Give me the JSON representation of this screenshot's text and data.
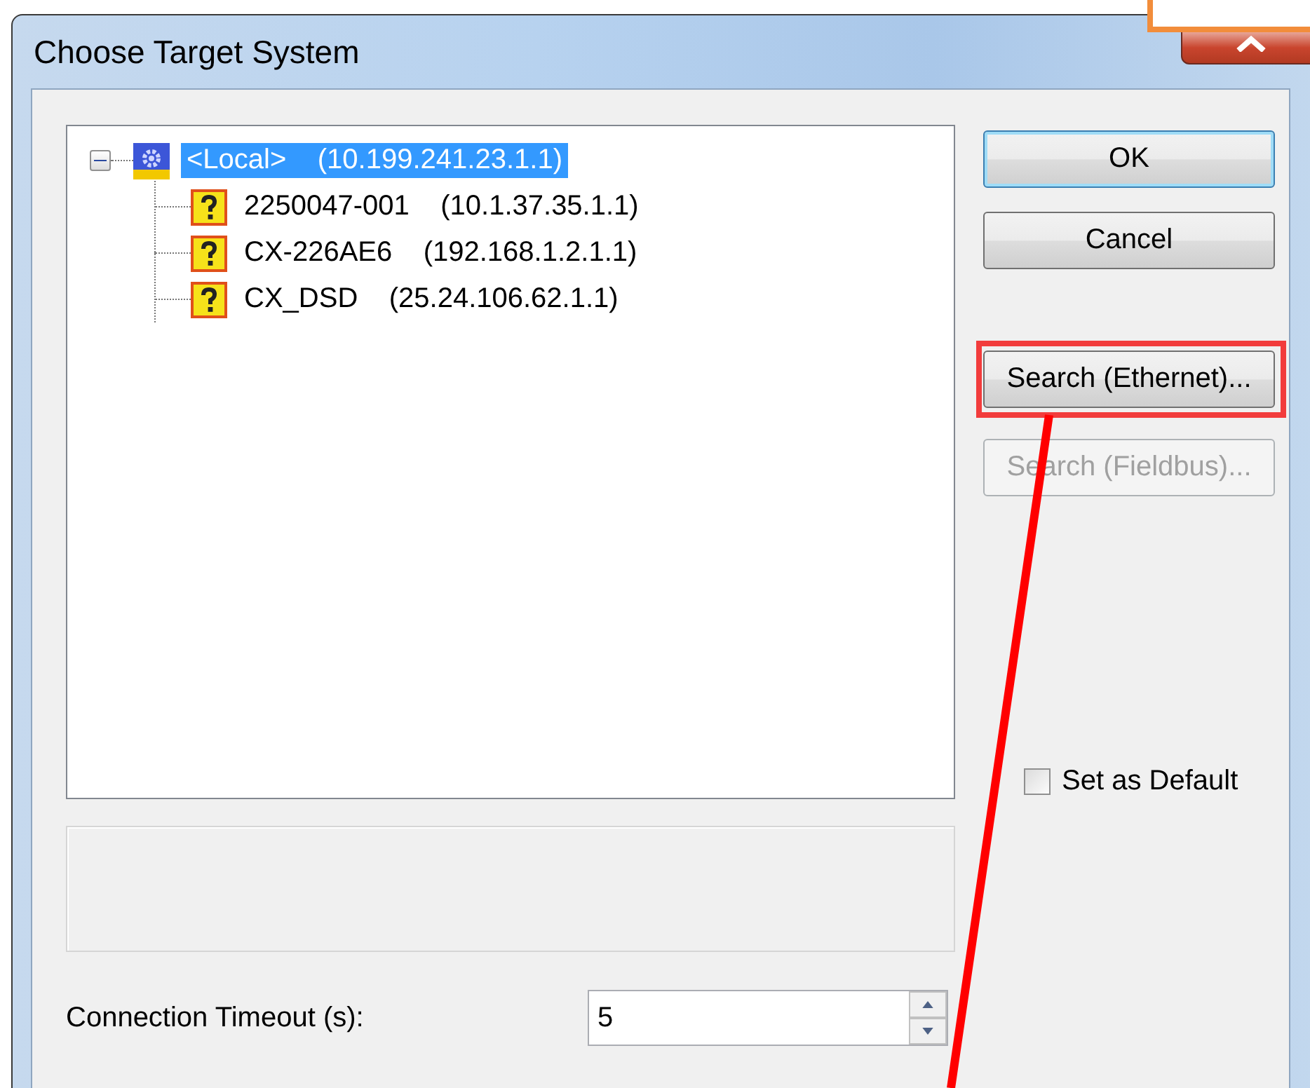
{
  "window": {
    "title": "Choose Target System"
  },
  "tree": {
    "root": {
      "name": "<Local>",
      "address": "(10.199.241.23.1.1)",
      "selected": true,
      "expanded": true,
      "children": [
        {
          "name": "2250047-001",
          "address": "(10.1.37.35.1.1)",
          "selected": false
        },
        {
          "name": "CX-226AE6",
          "address": "(192.168.1.2.1.1)",
          "selected": false
        },
        {
          "name": "CX_DSD",
          "address": "(25.24.106.62.1.1)",
          "selected": false
        }
      ]
    }
  },
  "buttons": [
    {
      "label": "OK",
      "kind": "default",
      "disabled": false,
      "highlighted": false
    },
    {
      "label": "Cancel",
      "kind": "normal",
      "disabled": false,
      "highlighted": false
    },
    {
      "label": "Search (Ethernet)...",
      "kind": "normal",
      "disabled": false,
      "highlighted": true
    },
    {
      "label": "Search (Fieldbus)...",
      "kind": "normal",
      "disabled": true,
      "highlighted": false
    }
  ],
  "set_as_default": {
    "label": "Set as Default",
    "checked": false
  },
  "connection_timeout": {
    "label": "Connection Timeout (s):",
    "value": "5"
  }
}
